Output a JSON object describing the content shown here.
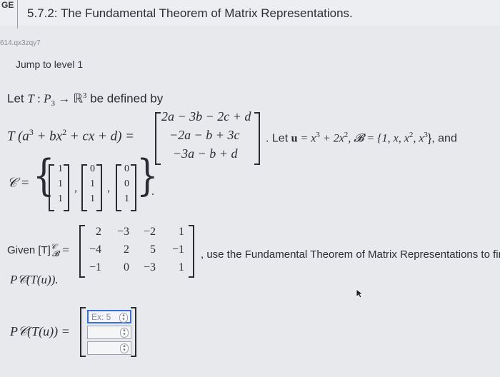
{
  "header": {
    "tag": "GE",
    "title": "5.7.2: The Fundamental Theorem of Matrix Representations."
  },
  "id_tag": "614.qx3zqy7",
  "jump_link": "Jump to level 1",
  "problem": {
    "let_prefix": "Let ",
    "let_T": "T",
    "let_map": " : ",
    "let_P": "P",
    "let_P_sub": "3",
    "let_arrow": " → ",
    "let_R": "ℝ",
    "let_R_sup": "3",
    "let_suffix": " be defined by",
    "T_of": "T",
    "T_arg_open": " (a",
    "T_arg_mid1": " + bx",
    "T_arg_mid2": " + cx + d",
    "T_arg_close": ") =",
    "sup3": "3",
    "sup2": "2",
    "vector_rows": [
      "2a − 3b − 2c + d",
      "−2a − b + 3c",
      "−3a − b + d"
    ],
    "let_u_text": ". Let ",
    "u_bold": "u",
    "u_def": " = x",
    "u_def2": " + 2x",
    "basis_B": ", 𝓑 = {1, x, x",
    "basis_B2": ", x",
    "basis_B3": "}, and",
    "C_label": "𝒞 =",
    "C_vectors": [
      [
        "1",
        "1",
        "1"
      ],
      [
        "0",
        "1",
        "1"
      ],
      [
        "0",
        "0",
        "1"
      ]
    ],
    "C_commas": [
      ",",
      ","
    ],
    "C_tail": ".",
    "given_label": "Given [T]",
    "given_sub": "𝓑",
    "given_sup": "𝒞",
    "given_eq": "=",
    "matrix": [
      [
        "2",
        "−3",
        "−2",
        "1"
      ],
      [
        "−4",
        "2",
        "5",
        "−1"
      ],
      [
        "−1",
        "0",
        "−3",
        "1"
      ]
    ],
    "given_text": ", use the Fundamental Theorem of Matrix Representations to find",
    "find_tail": "P𝒞(T(u)).",
    "answer_label": "P𝒞(T(u)) =",
    "answer_fields": [
      {
        "value": "",
        "placeholder": "Ex: 5"
      },
      {
        "value": "",
        "placeholder": ""
      },
      {
        "value": "",
        "placeholder": ""
      }
    ]
  },
  "icons": {
    "stepper": "up-down-arrows-icon",
    "cursor": "mouse-pointer-icon"
  },
  "colors": {
    "background": "#e8e9ec",
    "text": "#2b2c33",
    "focus": "#3c6fd6"
  }
}
